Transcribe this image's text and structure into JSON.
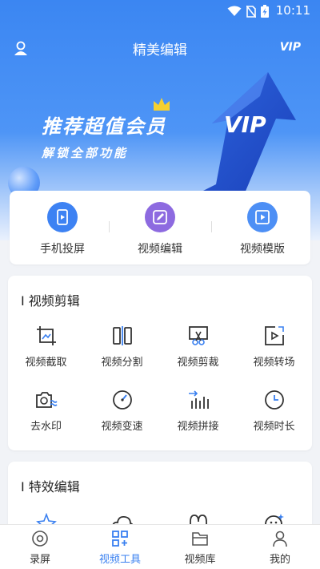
{
  "status_bar": {
    "time": "10:11"
  },
  "app_bar": {
    "title": "精美编辑",
    "vip": "VIP"
  },
  "banner": {
    "headline": "推荐超值会员",
    "subline": "解锁全部功能",
    "art_text": "VIP"
  },
  "quick_actions": [
    {
      "label": "手机投屏",
      "icon": "screen-cast-icon"
    },
    {
      "label": "视频编辑",
      "icon": "pen-edit-icon"
    },
    {
      "label": "视频模版",
      "icon": "video-template-icon"
    }
  ],
  "video_editing": {
    "title": "I 视频剪辑",
    "tools": [
      {
        "label": "视频截取",
        "icon": "crop-frame-icon"
      },
      {
        "label": "视频分割",
        "icon": "split-icon"
      },
      {
        "label": "视频剪裁",
        "icon": "scissors-icon"
      },
      {
        "label": "视频转场",
        "icon": "transition-icon"
      },
      {
        "label": "去水印",
        "icon": "camera-watermark-icon"
      },
      {
        "label": "视频变速",
        "icon": "speedometer-icon"
      },
      {
        "label": "视频拼接",
        "icon": "merge-bars-icon"
      },
      {
        "label": "视频时长",
        "icon": "clock-icon"
      }
    ]
  },
  "effects_editing": {
    "title": "I 特效编辑",
    "tools": [
      {
        "icon": "stars-icon"
      },
      {
        "icon": "cloud-icon"
      },
      {
        "icon": "arch-icon"
      },
      {
        "icon": "face-icon"
      }
    ]
  },
  "tab_bar": [
    {
      "label": "录屏",
      "icon": "record-icon",
      "active": false
    },
    {
      "label": "视频工具",
      "icon": "tools-grid-icon",
      "active": true
    },
    {
      "label": "视频库",
      "icon": "folder-icon",
      "active": false
    },
    {
      "label": "我的",
      "icon": "person-icon",
      "active": false
    }
  ],
  "colors": {
    "accent": "#3a80f0",
    "hero_top": "#3b86f2",
    "background": "#f1f3f7"
  }
}
